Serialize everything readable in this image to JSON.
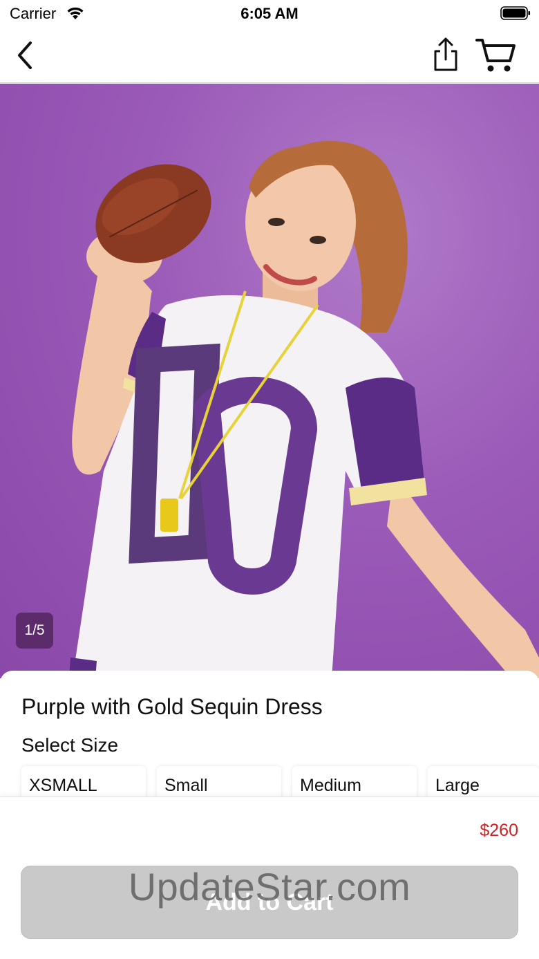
{
  "status_bar": {
    "carrier": "Carrier",
    "time": "6:05 AM"
  },
  "nav": {
    "back_icon": "chevron-left-icon",
    "share_icon": "share-icon",
    "cart_icon": "cart-icon"
  },
  "product": {
    "image_description_icon": "product-photo",
    "image_counter": "1/5",
    "title": "Purple with Gold Sequin Dress",
    "size_heading": "Select Size",
    "sizes": [
      "XSMALL",
      "Small",
      "Medium",
      "Large"
    ],
    "price": "$260"
  },
  "actions": {
    "add_to_cart_label": "Add to Cart"
  },
  "watermark": "UpdateStar.com",
  "colors": {
    "price": "#d42020",
    "button_disabled": "#c9c9c9",
    "background": "#9a5ab8"
  }
}
